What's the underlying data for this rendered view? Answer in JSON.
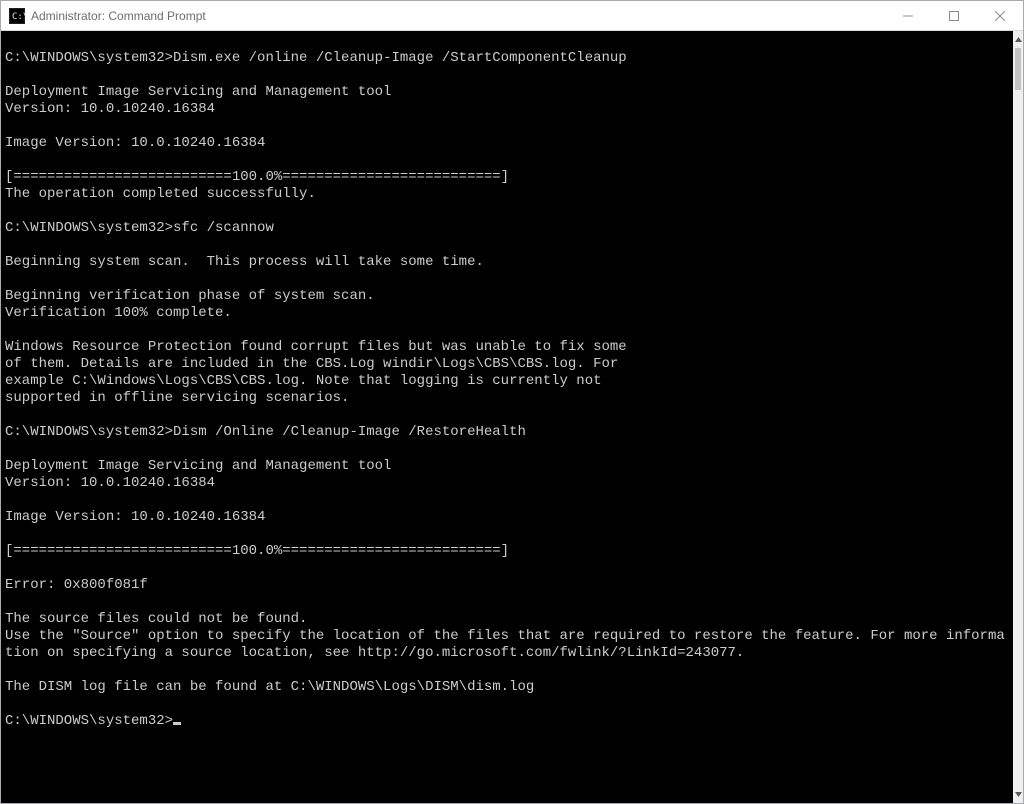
{
  "window": {
    "title": "Administrator: Command Prompt"
  },
  "colors": {
    "console_bg": "#000000",
    "console_fg": "#cccccc",
    "titlebar_fg": "#6d6d6d"
  },
  "console": {
    "prompt": "C:\\WINDOWS\\system32>",
    "lines": [
      "",
      "C:\\WINDOWS\\system32>Dism.exe /online /Cleanup-Image /StartComponentCleanup",
      "",
      "Deployment Image Servicing and Management tool",
      "Version: 10.0.10240.16384",
      "",
      "Image Version: 10.0.10240.16384",
      "",
      "[==========================100.0%==========================]",
      "The operation completed successfully.",
      "",
      "C:\\WINDOWS\\system32>sfc /scannow",
      "",
      "Beginning system scan.  This process will take some time.",
      "",
      "Beginning verification phase of system scan.",
      "Verification 100% complete.",
      "",
      "Windows Resource Protection found corrupt files but was unable to fix some",
      "of them. Details are included in the CBS.Log windir\\Logs\\CBS\\CBS.log. For",
      "example C:\\Windows\\Logs\\CBS\\CBS.log. Note that logging is currently not",
      "supported in offline servicing scenarios.",
      "",
      "C:\\WINDOWS\\system32>Dism /Online /Cleanup-Image /RestoreHealth",
      "",
      "Deployment Image Servicing and Management tool",
      "Version: 10.0.10240.16384",
      "",
      "Image Version: 10.0.10240.16384",
      "",
      "[==========================100.0%==========================]",
      "",
      "Error: 0x800f081f",
      "",
      "The source files could not be found.",
      "Use the \"Source\" option to specify the location of the files that are required to restore the feature. For more information on specifying a source location, see http://go.microsoft.com/fwlink/?LinkId=243077.",
      "",
      "The DISM log file can be found at C:\\WINDOWS\\Logs\\DISM\\dism.log",
      ""
    ]
  }
}
